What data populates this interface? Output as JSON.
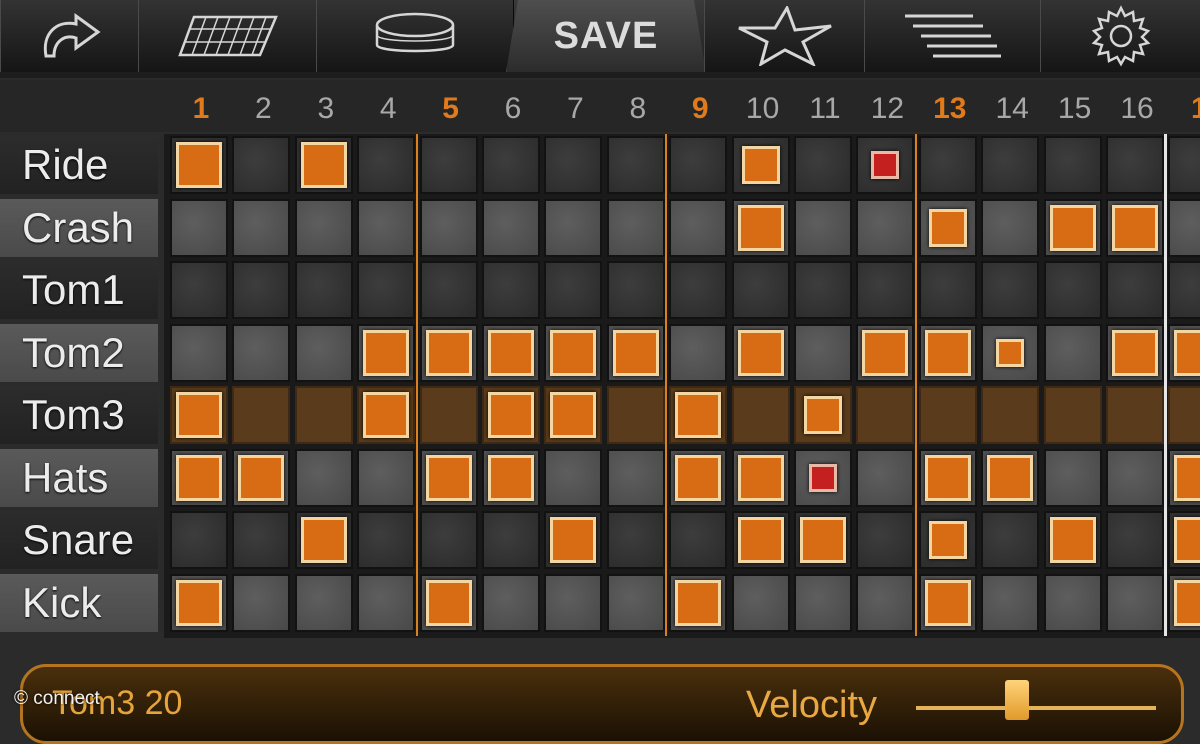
{
  "toolbar": {
    "items": [
      {
        "name": "undo-icon"
      },
      {
        "name": "keyboard-icon"
      },
      {
        "name": "drum-icon"
      },
      {
        "name": "save",
        "label": "SAVE"
      },
      {
        "name": "star-icon"
      },
      {
        "name": "menu-lines-icon"
      },
      {
        "name": "gear-icon"
      }
    ]
  },
  "steps": [
    "1",
    "2",
    "3",
    "4",
    "5",
    "6",
    "7",
    "8",
    "9",
    "10",
    "11",
    "12",
    "13",
    "14",
    "15",
    "16",
    "1"
  ],
  "tracks": [
    "Ride",
    "Crash",
    "Tom1",
    "Tom2",
    "Tom3",
    "Hats",
    "Snare",
    "Kick"
  ],
  "selected_track_index": 4,
  "pattern": {
    "Ride": {
      "notes": [
        1,
        3,
        10,
        12
      ],
      "small": [
        10
      ],
      "tiny": [
        12
      ],
      "red": [
        12
      ]
    },
    "Crash": {
      "notes": [
        10,
        13,
        15,
        16
      ],
      "small": [
        13
      ],
      "tiny": [],
      "red": []
    },
    "Tom1": {
      "notes": [],
      "small": [],
      "tiny": [],
      "red": []
    },
    "Tom2": {
      "notes": [
        4,
        5,
        6,
        7,
        8,
        10,
        12,
        13,
        14,
        16,
        17
      ],
      "small": [],
      "tiny": [
        14
      ],
      "red": []
    },
    "Tom3": {
      "notes": [
        1,
        4,
        6,
        7,
        9,
        11
      ],
      "small": [
        11
      ],
      "tiny": [],
      "red": []
    },
    "Hats": {
      "notes": [
        1,
        2,
        5,
        6,
        9,
        10,
        11,
        13,
        14,
        17
      ],
      "small": [],
      "tiny": [
        11
      ],
      "red": [
        11
      ]
    },
    "Snare": {
      "notes": [
        3,
        7,
        10,
        11,
        13,
        15,
        17
      ],
      "small": [
        13
      ],
      "tiny": [],
      "red": []
    },
    "Kick": {
      "notes": [
        1,
        5,
        9,
        13,
        17
      ],
      "small": [],
      "tiny": [],
      "red": []
    }
  },
  "bottom": {
    "info": "Tom3  20",
    "velocity_label": "Velocity",
    "velocity_value": 0.42
  },
  "watermark": "© connect",
  "colors": {
    "accent": "#d86c14",
    "red_note": "#c42020",
    "label_text": "#ececec"
  }
}
